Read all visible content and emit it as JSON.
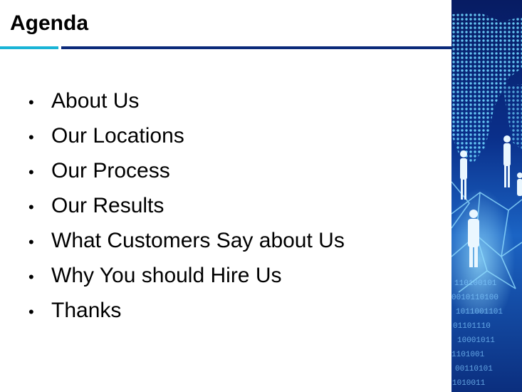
{
  "slide": {
    "title": "Agenda",
    "items": [
      {
        "label": "About Us"
      },
      {
        "label": "Our Locations"
      },
      {
        "label": "Our Process"
      },
      {
        "label": "Our Results"
      },
      {
        "label": "What Customers Say about Us"
      },
      {
        "label": "Why You should Hire Us"
      },
      {
        "label": "Thanks"
      }
    ],
    "bullet_glyph": "•"
  },
  "colors": {
    "accent_rule": "#19b4d6",
    "main_rule": "#0b2a7a",
    "image_background": "#0a2f8a",
    "image_highlight": "#5fd0ff"
  },
  "side_image": {
    "binary_rows": [
      "110100101",
      "0010110100",
      "1011001101",
      "01101110",
      "10001011",
      "1101001",
      "00110101",
      "1010011"
    ]
  }
}
